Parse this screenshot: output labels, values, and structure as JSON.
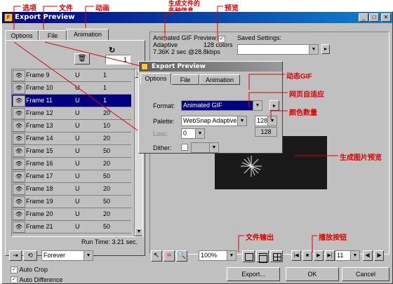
{
  "window": {
    "title": "Export Preview",
    "controls": [
      "_",
      "□",
      "✕"
    ]
  },
  "tabs": [
    "Options",
    "File",
    "Animation"
  ],
  "frames": [
    {
      "name": "Frame 9",
      "disposal": "U",
      "delay": "1"
    },
    {
      "name": "Frame 10",
      "disposal": "U",
      "delay": "1"
    },
    {
      "name": "Frame 11",
      "disposal": "U",
      "delay": "1",
      "selected": true
    },
    {
      "name": "Frame 12",
      "disposal": "U",
      "delay": "20"
    },
    {
      "name": "Frame 13",
      "disposal": "U",
      "delay": "10"
    },
    {
      "name": "Frame 14",
      "disposal": "U",
      "delay": "20"
    },
    {
      "name": "Frame 15",
      "disposal": "U",
      "delay": "50"
    },
    {
      "name": "Frame 16",
      "disposal": "U",
      "delay": "20"
    },
    {
      "name": "Frame 17",
      "disposal": "U",
      "delay": "50"
    },
    {
      "name": "Frame 18",
      "disposal": "U",
      "delay": "20"
    },
    {
      "name": "Frame 19",
      "disposal": "U",
      "delay": "50"
    },
    {
      "name": "Frame 20",
      "disposal": "U",
      "delay": "20"
    },
    {
      "name": "Frame 21",
      "disposal": "U",
      "delay": "50"
    }
  ],
  "frame_counter": "1",
  "run_time": "Run Time: 3.21 sec.",
  "loop": {
    "value": "Forever"
  },
  "checkboxes": {
    "auto_crop": "Auto Crop",
    "auto_difference": "Auto Difference"
  },
  "info": {
    "format": "Animated GIF",
    "palette": "Adaptive",
    "colors": "128 colors",
    "size": "7.36K  2 sec @28.8kbps",
    "preview_label": "Preview"
  },
  "saved_settings": {
    "label": "Saved Settings:"
  },
  "inner": {
    "title": "Export Preview",
    "tabs": [
      "Options",
      "File",
      "Animation"
    ],
    "format_label": "Format:",
    "format_value": "Animated GIF",
    "palette_label": "Palette:",
    "palette_value": "WebSnap Adaptive",
    "loss_label": "Loss:",
    "loss_value": "0",
    "dither_label": "Dither:",
    "colors_value": "128",
    "colors_option": "128"
  },
  "toolbar": {
    "zoom": "100%",
    "frame": "11"
  },
  "buttons": {
    "export": "Export...",
    "ok": "OK",
    "cancel": "Cancel"
  },
  "annotations": {
    "options": "选项",
    "file": "文件",
    "animation": "动画",
    "info": "生成文件的\n各种信息",
    "preview": "预览",
    "animated_gif": "动态GIF",
    "web_adapt": "网页自适应",
    "color_count": "颜色数量",
    "preview_img": "生成图片预览",
    "file_output": "文件输出",
    "play_buttons": "播放按钮"
  }
}
